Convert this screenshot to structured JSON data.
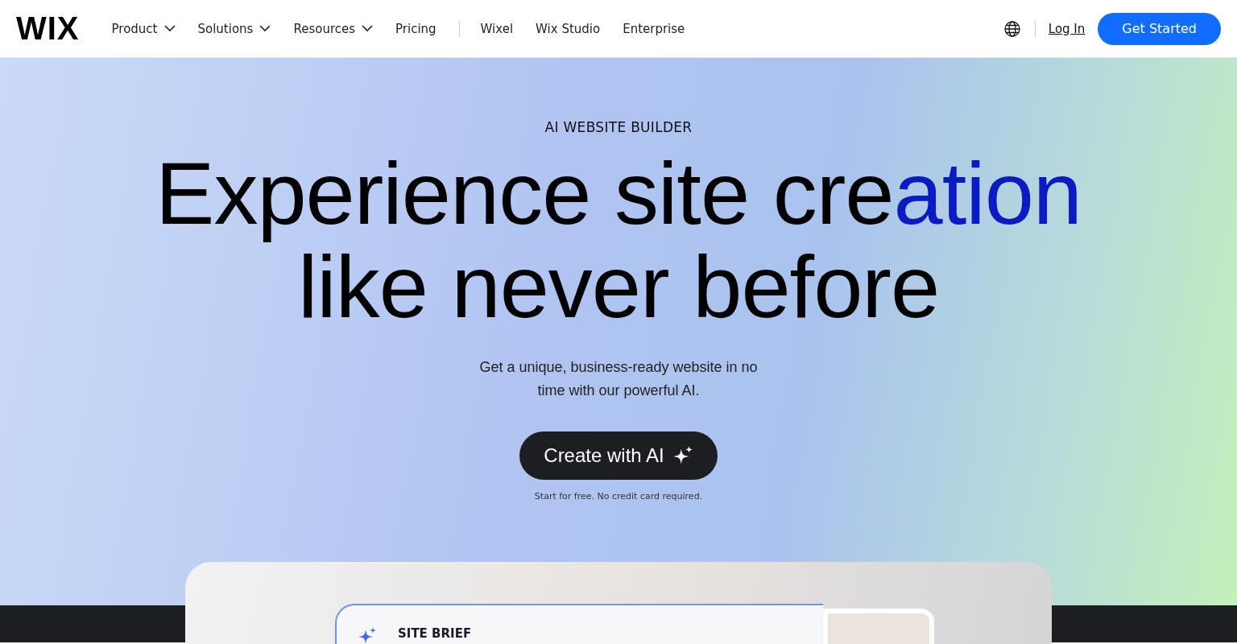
{
  "header": {
    "logo": "WIX",
    "nav": [
      {
        "label": "Product",
        "dropdown": true
      },
      {
        "label": "Solutions",
        "dropdown": true
      },
      {
        "label": "Resources",
        "dropdown": true
      },
      {
        "label": "Pricing",
        "dropdown": false
      }
    ],
    "nav_secondary": [
      "Wixel",
      "Wix Studio",
      "Enterprise"
    ],
    "login": "Log In",
    "cta": "Get Started"
  },
  "hero": {
    "eyebrow": "AI WEBSITE BUILDER",
    "headline": [
      [
        {
          "text": "Experience site cre",
          "accent": false
        },
        {
          "text": "ation",
          "accent": true
        }
      ],
      [
        {
          "text": "like never before",
          "accent": false
        }
      ]
    ],
    "subtitle": "Get a unique, business-ready website in no time with our powerful AI.",
    "button": "Create with AI",
    "note": "Start for free. No credit card required."
  },
  "preview": {
    "brief_title": "SITE BRIEF"
  }
}
